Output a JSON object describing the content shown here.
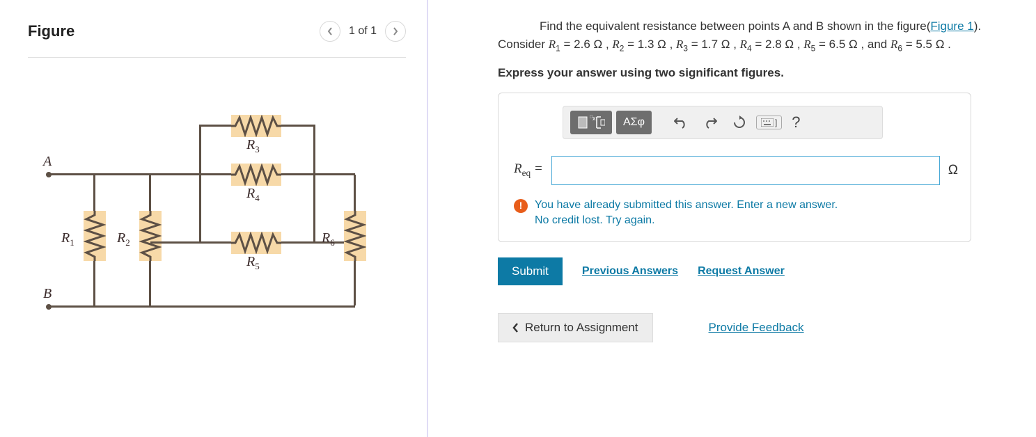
{
  "figure": {
    "title": "Figure",
    "counter": "1 of 1",
    "labels": {
      "A": "A",
      "B": "B",
      "R1": "R",
      "R1s": "1",
      "R2": "R",
      "R2s": "2",
      "R3": "R",
      "R3s": "3",
      "R4": "R",
      "R4s": "4",
      "R5": "R",
      "R5s": "5",
      "R6": "R",
      "R6s": "6"
    }
  },
  "problem": {
    "lead": "Find the equivalent resistance between points A and B shown in the figure(",
    "figlink": "Figure 1",
    "after_link": "). Consider ",
    "R1": "R",
    "R1s": "1",
    "R1v": " = 2.6 Ω , ",
    "R2": "R",
    "R2s": "2",
    "R2v": " = 1.3 Ω , ",
    "R3": "R",
    "R3s": "3",
    "R3v": " = 1.7 Ω , ",
    "R4": "R",
    "R4s": "4",
    "R4v": " = 2.8 Ω , ",
    "R5": "R",
    "R5s": "5",
    "R5v": " = 6.5 Ω , and ",
    "R6": "R",
    "R6s": "6",
    "R6v": " = 5.5 Ω .",
    "instruction": "Express your answer using two significant figures."
  },
  "toolbar": {
    "greek": "ΑΣφ",
    "help": "?"
  },
  "answer": {
    "lhs": "R",
    "lhs_sub": "eq",
    "eq": " = ",
    "unit": "Ω",
    "value": ""
  },
  "feedback": {
    "line1": "You have already submitted this answer. Enter a new answer.",
    "line2": "No credit lost. Try again."
  },
  "actions": {
    "submit": "Submit",
    "prev": "Previous Answers",
    "request": "Request Answer"
  },
  "bottom": {
    "return": "Return to Assignment",
    "provide": "Provide Feedback"
  }
}
